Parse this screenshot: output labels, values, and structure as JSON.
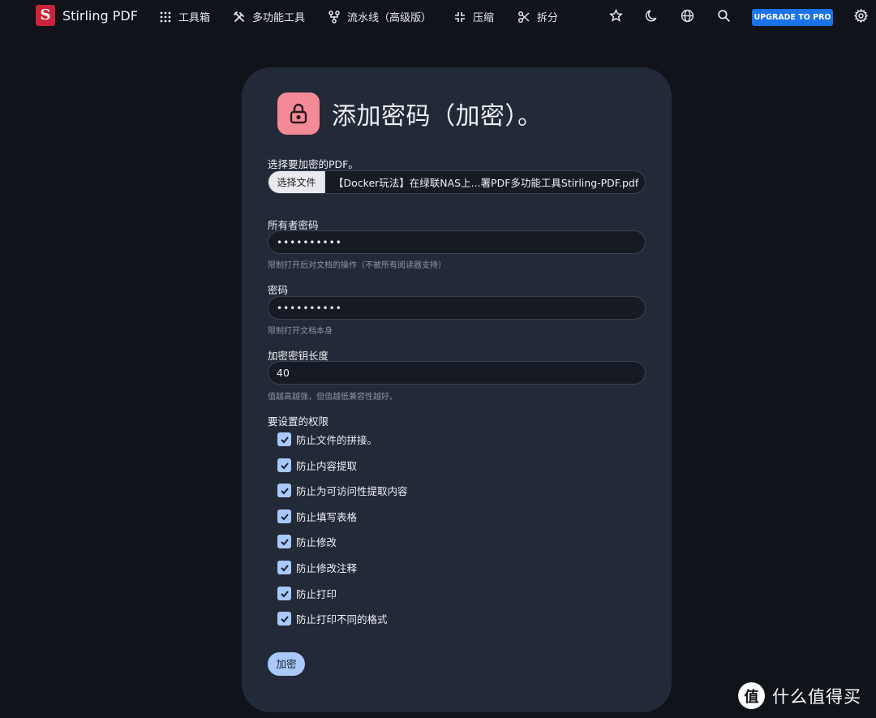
{
  "nav": {
    "brand": "Stirling PDF",
    "items": [
      {
        "label": "工具箱",
        "icon": "grid-icon"
      },
      {
        "label": "多功能工具",
        "icon": "tools-icon"
      },
      {
        "label": "流水线（高级版）",
        "icon": "pipeline-icon"
      },
      {
        "label": "压缩",
        "icon": "compress-icon"
      },
      {
        "label": "拆分",
        "icon": "scissors-icon"
      }
    ],
    "right_icons": [
      "star-icon",
      "moon-icon",
      "globe-icon",
      "search-icon",
      "gear-icon"
    ],
    "upgrade_label": "UPGRADE TO PRO"
  },
  "form": {
    "title": "添加密码（加密）。",
    "file_label": "选择要加密的PDF。",
    "file_button": "选择文件",
    "file_name": "【Docker玩法】在绿联NAS上...署PDF多功能工具Stirling-PDF.pdf",
    "owner_label": "所有者密码",
    "owner_value": "••••••••••",
    "owner_help": "限制打开后对文档的操作（不被所有阅读器支持）",
    "password_label": "密码",
    "password_value": "••••••••••",
    "password_help": "限制打开文档本身",
    "keylen_label": "加密密钥长度",
    "keylen_value": "40",
    "keylen_help": "值越高越强，但值越低兼容性越好。",
    "perm_label": "要设置的权限",
    "permissions": [
      {
        "label": "防止文件的拼接。",
        "checked": true
      },
      {
        "label": "防止内容提取",
        "checked": true
      },
      {
        "label": "防止为可访问性提取内容",
        "checked": true
      },
      {
        "label": "防止填写表格",
        "checked": true
      },
      {
        "label": "防止修改",
        "checked": true
      },
      {
        "label": "防止修改注释",
        "checked": true
      },
      {
        "label": "防止打印",
        "checked": true
      },
      {
        "label": "防止打印不同的格式",
        "checked": true
      }
    ],
    "submit_label": "加密"
  },
  "watermark": {
    "text": "什么值得买",
    "glyph": "值"
  },
  "colors": {
    "background": "#11131a",
    "card": "#232a37",
    "lock_accent": "#f48a96",
    "checkbox": "#a9c8fb",
    "upgrade_button": "#1a73e8"
  }
}
